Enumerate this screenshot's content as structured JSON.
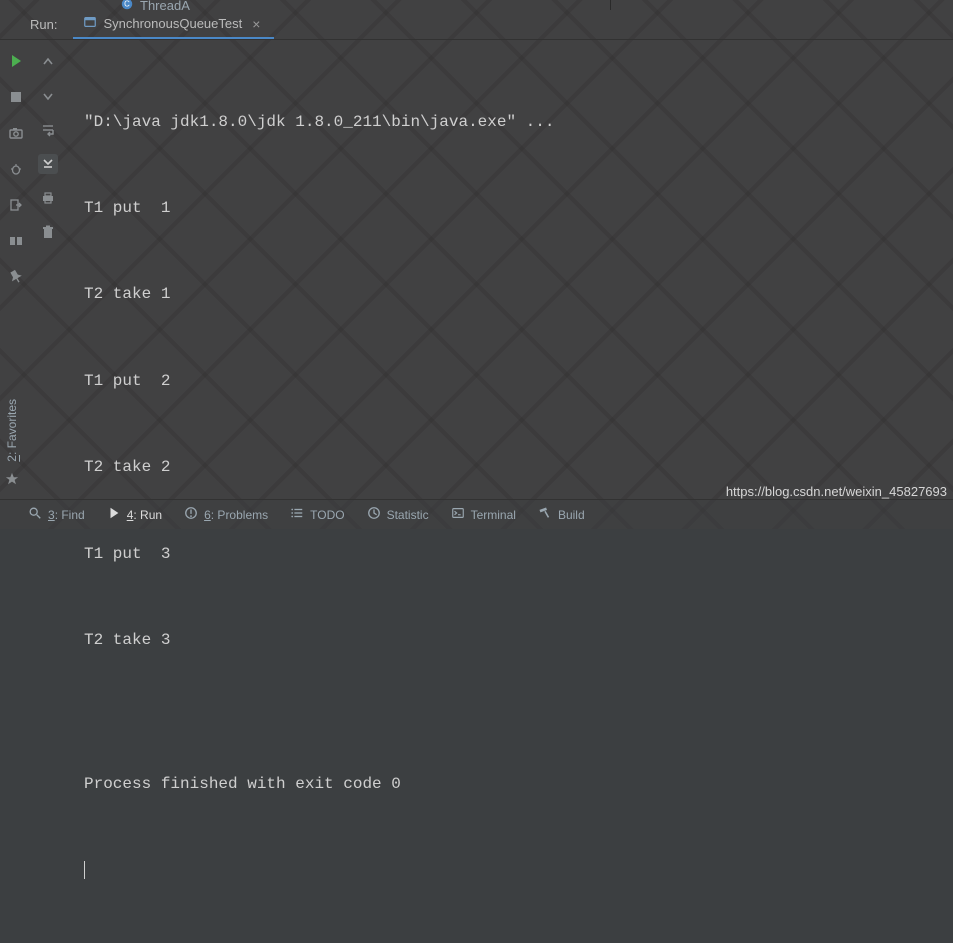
{
  "top": {
    "partial_tab": "ThreadA"
  },
  "run": {
    "label": "Run:",
    "tab_name": "SynchronousQueueTest"
  },
  "console_lines": [
    "\"D:\\java jdk1.8.0\\jdk 1.8.0_211\\bin\\java.exe\" ...",
    "T1 put  1",
    "T2 take 1",
    "T1 put  2",
    "T2 take 2",
    "T1 put  3",
    "T2 take 3",
    "",
    "Process finished with exit code 0"
  ],
  "left_sidebar": {
    "favorites_label": "2: Favorites"
  },
  "bottom_tabs": {
    "find": "3: Find",
    "run": "4: Run",
    "problems": "6: Problems",
    "todo": "TODO",
    "statistic": "Statistic",
    "terminal": "Terminal",
    "build": "Build"
  },
  "watermark": "https://blog.csdn.net/weixin_45827693"
}
